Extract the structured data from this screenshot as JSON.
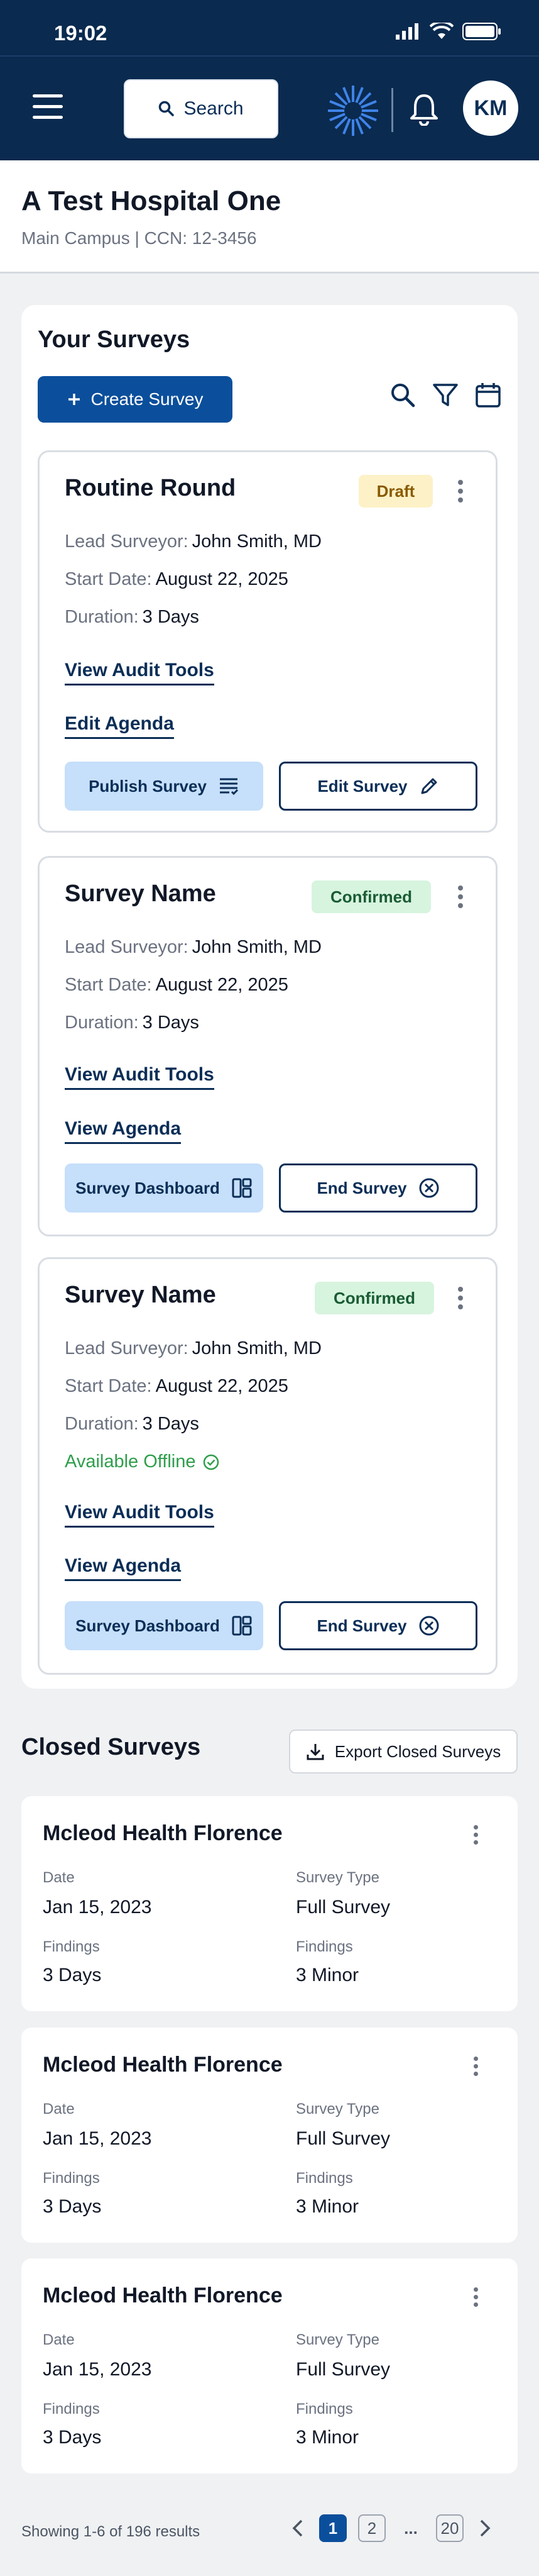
{
  "status": {
    "time": "19:02"
  },
  "header": {
    "search_label": "Search",
    "avatar_initials": "KM"
  },
  "hospital": {
    "name": "A Test Hospital One",
    "subtitle": "Main Campus | CCN: 12-3456"
  },
  "your_surveys": {
    "title": "Your Surveys",
    "create_label": "Create Survey",
    "cards": [
      {
        "title": "Routine Round",
        "badge": "Draft",
        "lead_label": "Lead Surveyor:",
        "lead": "John Smith, MD",
        "start_label": "Start Date:",
        "start": "August 22, 2025",
        "duration_label": "Duration:",
        "duration": "3 Days",
        "link1": "View Audit Tools",
        "link2": "Edit Agenda",
        "btn1": "Publish Survey",
        "btn2": "Edit Survey"
      },
      {
        "title": "Survey Name",
        "badge": "Confirmed",
        "lead_label": "Lead Surveyor:",
        "lead": "John Smith, MD",
        "start_label": "Start Date:",
        "start": "August 22, 2025",
        "duration_label": "Duration:",
        "duration": "3 Days",
        "link1": "View Audit Tools",
        "link2": "View Agenda",
        "btn1": "Survey Dashboard",
        "btn2": "End Survey"
      },
      {
        "title": "Survey Name",
        "badge": "Confirmed",
        "lead_label": "Lead Surveyor:",
        "lead": "John Smith, MD",
        "start_label": "Start Date:",
        "start": "August 22, 2025",
        "duration_label": "Duration:",
        "duration": "3 Days",
        "offline": "Available Offline",
        "link1": "View Audit Tools",
        "link2": "View Agenda",
        "btn1": "Survey Dashboard",
        "btn2": "End Survey"
      }
    ]
  },
  "closed": {
    "title": "Closed Surveys",
    "export_label": "Export Closed Surveys",
    "cards": [
      {
        "name": "Mcleod Health Florence",
        "date_label": "Date",
        "date": "Jan 15, 2023",
        "type_label": "Survey Type",
        "type": "Full Survey",
        "findings_label": "Findings",
        "findings": "3 Days",
        "findings2_label": "Findings",
        "findings2": "3 Minor"
      },
      {
        "name": "Mcleod Health Florence",
        "date_label": "Date",
        "date": "Jan 15, 2023",
        "type_label": "Survey Type",
        "type": "Full Survey",
        "findings_label": "Findings",
        "findings": "3 Days",
        "findings2_label": "Findings",
        "findings2": "3 Minor"
      },
      {
        "name": "Mcleod Health Florence",
        "date_label": "Date",
        "date": "Jan 15, 2023",
        "type_label": "Survey Type",
        "type": "Full Survey",
        "findings_label": "Findings",
        "findings": "3 Days",
        "findings2_label": "Findings",
        "findings2": "3 Minor"
      }
    ]
  },
  "pagination": {
    "summary": "Showing 1-6 of 196 results",
    "pages": [
      "1",
      "2",
      "...",
      "20"
    ]
  },
  "colors": {
    "navy": "#0a2a4f",
    "primary": "#0b4f9c",
    "draft_bg": "#fdf1c7",
    "confirmed_bg": "#d7f4df",
    "offline": "#2e9e4b"
  }
}
